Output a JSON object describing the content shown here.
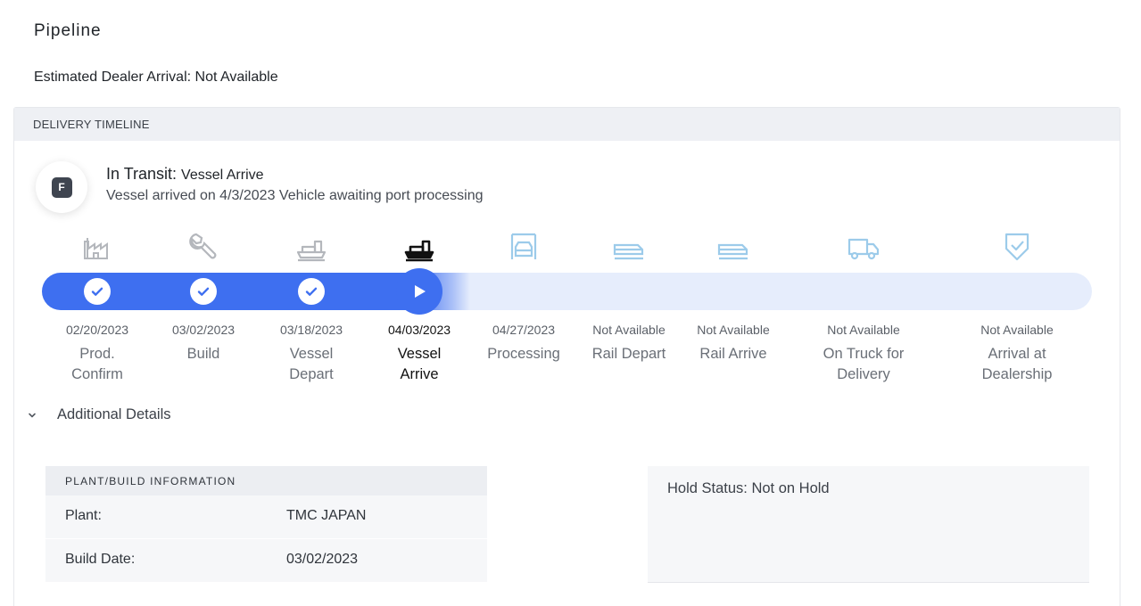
{
  "page": {
    "title": "Pipeline"
  },
  "eta": {
    "text": "Estimated Dealer Arrival: Not Available"
  },
  "timeline": {
    "header": "DELIVERY TIMELINE",
    "badge_letter": "F",
    "status_label": "In Transit:",
    "status_value": "Vessel Arrive",
    "status_description": "Vessel arrived on 4/3/2023 Vehicle awaiting port processing",
    "steps": [
      {
        "date": "02/20/2023",
        "name": "Prod.\nConfirm",
        "state": "complete",
        "icon": "factory-icon"
      },
      {
        "date": "03/02/2023",
        "name": "Build",
        "state": "complete",
        "icon": "wrench-icon"
      },
      {
        "date": "03/18/2023",
        "name": "Vessel\nDepart",
        "state": "complete",
        "icon": "ship-icon"
      },
      {
        "date": "04/03/2023",
        "name": "Vessel\nArrive",
        "state": "current",
        "icon": "ship-icon"
      },
      {
        "date": "04/27/2023",
        "name": "Processing",
        "state": "upcoming",
        "icon": "car-processing-icon"
      },
      {
        "date": "Not Available",
        "name": "Rail Depart",
        "state": "upcoming",
        "icon": "train-icon"
      },
      {
        "date": "Not Available",
        "name": "Rail Arrive",
        "state": "upcoming",
        "icon": "train-icon"
      },
      {
        "date": "Not Available",
        "name": "On Truck for\nDelivery",
        "state": "upcoming",
        "icon": "truck-icon"
      },
      {
        "date": "Not Available",
        "name": "Arrival at\nDealership",
        "state": "upcoming",
        "icon": "shield-check-icon"
      }
    ],
    "colors": {
      "complete": "#b4b7bc",
      "current": "#111111",
      "upcoming": "#9ccbea",
      "accent": "#3e6ff0",
      "track": "#e6edfc"
    }
  },
  "details": {
    "toggle_label": "Additional Details",
    "plant": {
      "header": "PLANT/BUILD INFORMATION",
      "rows": [
        {
          "key": "Plant:",
          "value": "TMC JAPAN"
        },
        {
          "key": "Build Date:",
          "value": "03/02/2023"
        }
      ]
    },
    "hold_status": "Hold Status: Not on Hold"
  }
}
